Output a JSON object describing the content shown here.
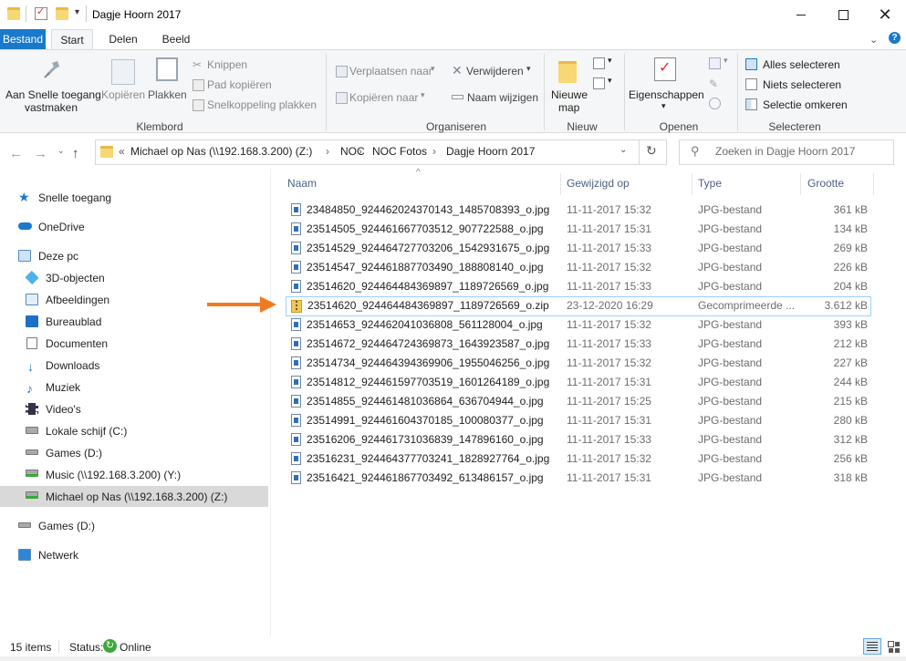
{
  "window": {
    "title": "Dagje Hoorn 2017"
  },
  "ribbon_tabs": {
    "file": "Bestand",
    "start": "Start",
    "share": "Delen",
    "view": "Beeld"
  },
  "ribbon": {
    "pin": "Aan Snelle toegang\nvastmaken",
    "pin_line1": "Aan Snelle toegang",
    "pin_line2": "vastmaken",
    "copy": "Kopiëren",
    "paste": "Plakken",
    "cut": "Knippen",
    "copy_path": "Pad kopiëren",
    "paste_shortcut": "Snelkoppeling plakken",
    "group_clipboard": "Klembord",
    "move_to": "Verplaatsen naar",
    "copy_to": "Kopiëren naar",
    "delete": "Verwijderen",
    "rename": "Naam wijzigen",
    "group_organize": "Organiseren",
    "new_folder_line1": "Nieuwe",
    "new_folder_line2": "map",
    "group_new": "Nieuw",
    "properties": "Eigenschappen",
    "group_open": "Openen",
    "select_all": "Alles selecteren",
    "select_none": "Niets selecteren",
    "invert_selection": "Selectie omkeren",
    "group_select": "Selecteren"
  },
  "address": {
    "chevron": "«",
    "crumbs": [
      "Michael op Nas (\\\\192.168.3.200) (Z:)",
      "NOC",
      "NOC Fotos",
      "Dagje Hoorn 2017"
    ],
    "separator": "›",
    "search_placeholder": "Zoeken in Dagje Hoorn 2017"
  },
  "sidebar": {
    "items": [
      {
        "label": "Snelle toegang"
      },
      {
        "label": "OneDrive"
      },
      {
        "label": "Deze pc"
      },
      {
        "label": "3D-objecten"
      },
      {
        "label": "Afbeeldingen"
      },
      {
        "label": "Bureaublad"
      },
      {
        "label": "Documenten"
      },
      {
        "label": "Downloads"
      },
      {
        "label": "Muziek"
      },
      {
        "label": "Video's"
      },
      {
        "label": "Lokale schijf (C:)"
      },
      {
        "label": "Games (D:)"
      },
      {
        "label": "Music (\\\\192.168.3.200) (Y:)"
      },
      {
        "label": "Michael op Nas (\\\\192.168.3.200) (Z:)"
      },
      {
        "label": "Games (D:)"
      },
      {
        "label": "Netwerk"
      }
    ]
  },
  "columns": {
    "name": "Naam",
    "modified": "Gewijzigd op",
    "type": "Type",
    "size": "Grootte"
  },
  "files": [
    {
      "name": "23484850_924462024370143_1485708393_o.jpg",
      "date": "11-11-2017 15:32",
      "type": "JPG-bestand",
      "size": "361 kB"
    },
    {
      "name": "23514505_924461667703512_907722588_o.jpg",
      "date": "11-11-2017 15:31",
      "type": "JPG-bestand",
      "size": "134 kB"
    },
    {
      "name": "23514529_924464727703206_1542931675_o.jpg",
      "date": "11-11-2017 15:33",
      "type": "JPG-bestand",
      "size": "269 kB"
    },
    {
      "name": "23514547_924461887703490_188808140_o.jpg",
      "date": "11-11-2017 15:32",
      "type": "JPG-bestand",
      "size": "226 kB"
    },
    {
      "name": "23514620_924464484369897_1189726569_o.jpg",
      "date": "11-11-2017 15:33",
      "type": "JPG-bestand",
      "size": "204 kB"
    },
    {
      "name": "23514620_924464484369897_1189726569_o.zip",
      "date": "23-12-2020 16:29",
      "type": "Gecomprimeerde ...",
      "size": "3.612 kB"
    },
    {
      "name": "23514653_924462041036808_561128004_o.jpg",
      "date": "11-11-2017 15:32",
      "type": "JPG-bestand",
      "size": "393 kB"
    },
    {
      "name": "23514672_924464724369873_1643923587_o.jpg",
      "date": "11-11-2017 15:33",
      "type": "JPG-bestand",
      "size": "212 kB"
    },
    {
      "name": "23514734_924464394369906_1955046256_o.jpg",
      "date": "11-11-2017 15:32",
      "type": "JPG-bestand",
      "size": "227 kB"
    },
    {
      "name": "23514812_924461597703519_1601264189_o.jpg",
      "date": "11-11-2017 15:31",
      "type": "JPG-bestand",
      "size": "244 kB"
    },
    {
      "name": "23514855_924461481036864_636704944_o.jpg",
      "date": "11-11-2017 15:25",
      "type": "JPG-bestand",
      "size": "215 kB"
    },
    {
      "name": "23514991_924461604370185_100080377_o.jpg",
      "date": "11-11-2017 15:31",
      "type": "JPG-bestand",
      "size": "280 kB"
    },
    {
      "name": "23516206_924461731036839_147896160_o.jpg",
      "date": "11-11-2017 15:33",
      "type": "JPG-bestand",
      "size": "312 kB"
    },
    {
      "name": "23516231_924464377703241_1828927764_o.jpg",
      "date": "11-11-2017 15:32",
      "type": "JPG-bestand",
      "size": "256 kB"
    },
    {
      "name": "23516421_924461867703492_613486157_o.jpg",
      "date": "11-11-2017 15:31",
      "type": "JPG-bestand",
      "size": "318 kB"
    }
  ],
  "status": {
    "count": "15 items",
    "label": "Status:",
    "online": "Online"
  },
  "colors": {
    "accent": "#1979ca",
    "arrow": "#f07a22",
    "selection_border": "#99d1ff",
    "online_green": "#3aa83a"
  }
}
